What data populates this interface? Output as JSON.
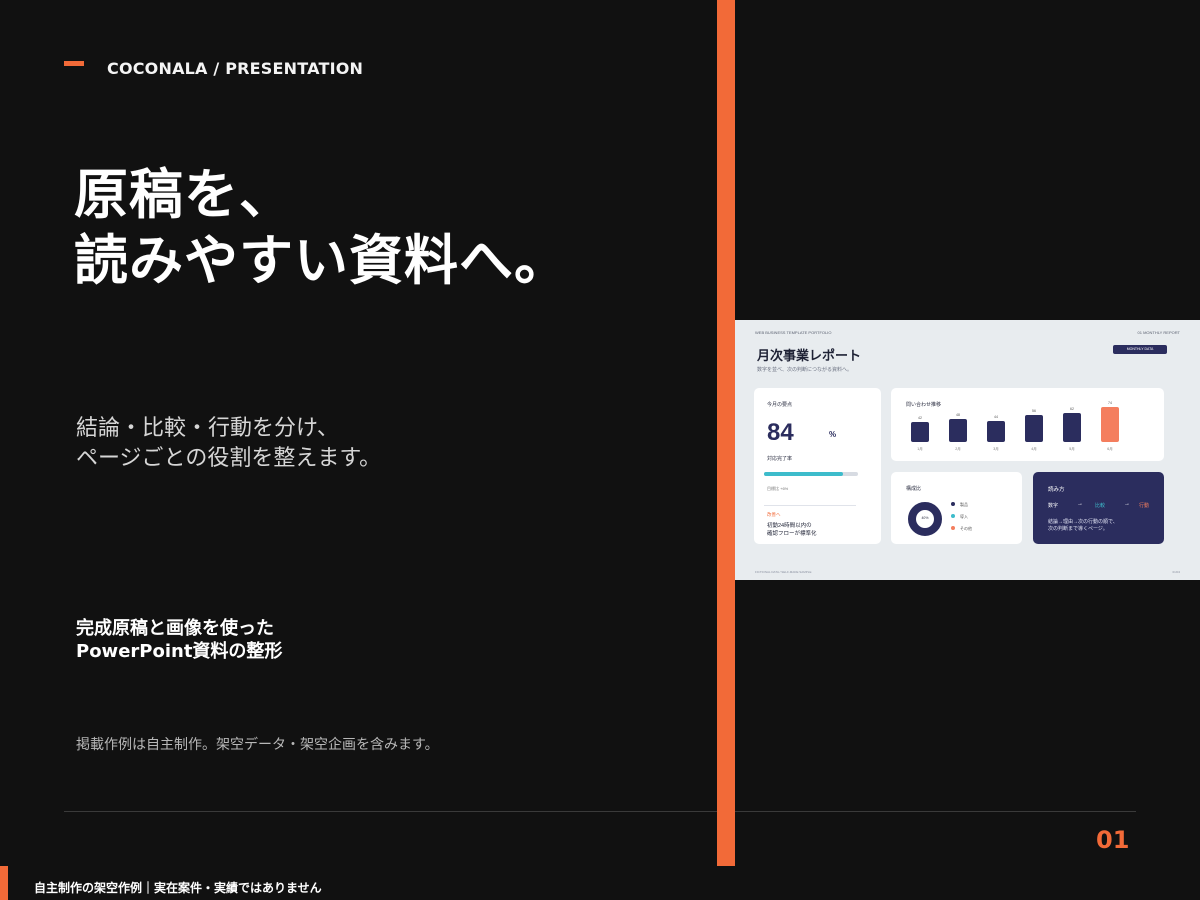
{
  "header": {
    "brand": "COCONALA / PRESENTATION"
  },
  "hero": {
    "line1": "原稿を、",
    "line2": "読みやすい資料へ。"
  },
  "description": {
    "line1": "結論・比較・行動を分け、",
    "line2": "ページごとの役割を整えます。"
  },
  "service": {
    "line1": "完成原稿と画像を使った",
    "line2": "PowerPoint資料の整形"
  },
  "disclaimer": "掲載作例は自主制作。架空データ・架空企画を含みます。",
  "page_number": "01",
  "footer_note": "自主制作の架空作例｜実在案件・実績ではありません",
  "colors": {
    "accent": "#f26a38",
    "background": "#111111",
    "navy": "#2b2d5e",
    "teal": "#3dbccb",
    "coral": "#f47e5e"
  },
  "preview": {
    "top_left": "WEB BUSINESS TEMPLATE PORTFOLIO",
    "top_right": "01 MONTHLY REPORT",
    "title": "月次事業レポート",
    "subtitle": "数字を並べ、次の判断につながる資料へ。",
    "button": "MONTHLY DATA",
    "kpi": {
      "label": "今月の要点",
      "value": "84",
      "unit": "%",
      "caption": "対応完了率",
      "progress": 0.84,
      "target": "目標比 +6%",
      "status": "改善へ",
      "note1": "初動24時間以内の",
      "note2": "確認フローが標準化"
    },
    "chart_data": {
      "type": "bar",
      "title": "問い合わせ推移",
      "categories": [
        "1月",
        "2月",
        "3月",
        "4月",
        "5月",
        "6月"
      ],
      "values": [
        42,
        48,
        44,
        56,
        62,
        74
      ],
      "ylim": [
        0,
        80
      ]
    },
    "donut": {
      "title": "構成比",
      "center": "40%",
      "legend": [
        "製品",
        "導入",
        "その他"
      ]
    },
    "flow": {
      "title": "読み方",
      "steps": [
        "数字",
        "比較",
        "行動"
      ],
      "note1": "結論→理由→次の行動の順で、",
      "note2": "次の判断まで導くページ。"
    },
    "footer_left": "FICTIONAL DATA / SELF-MADE SAMPLE",
    "footer_right": "01/04"
  }
}
